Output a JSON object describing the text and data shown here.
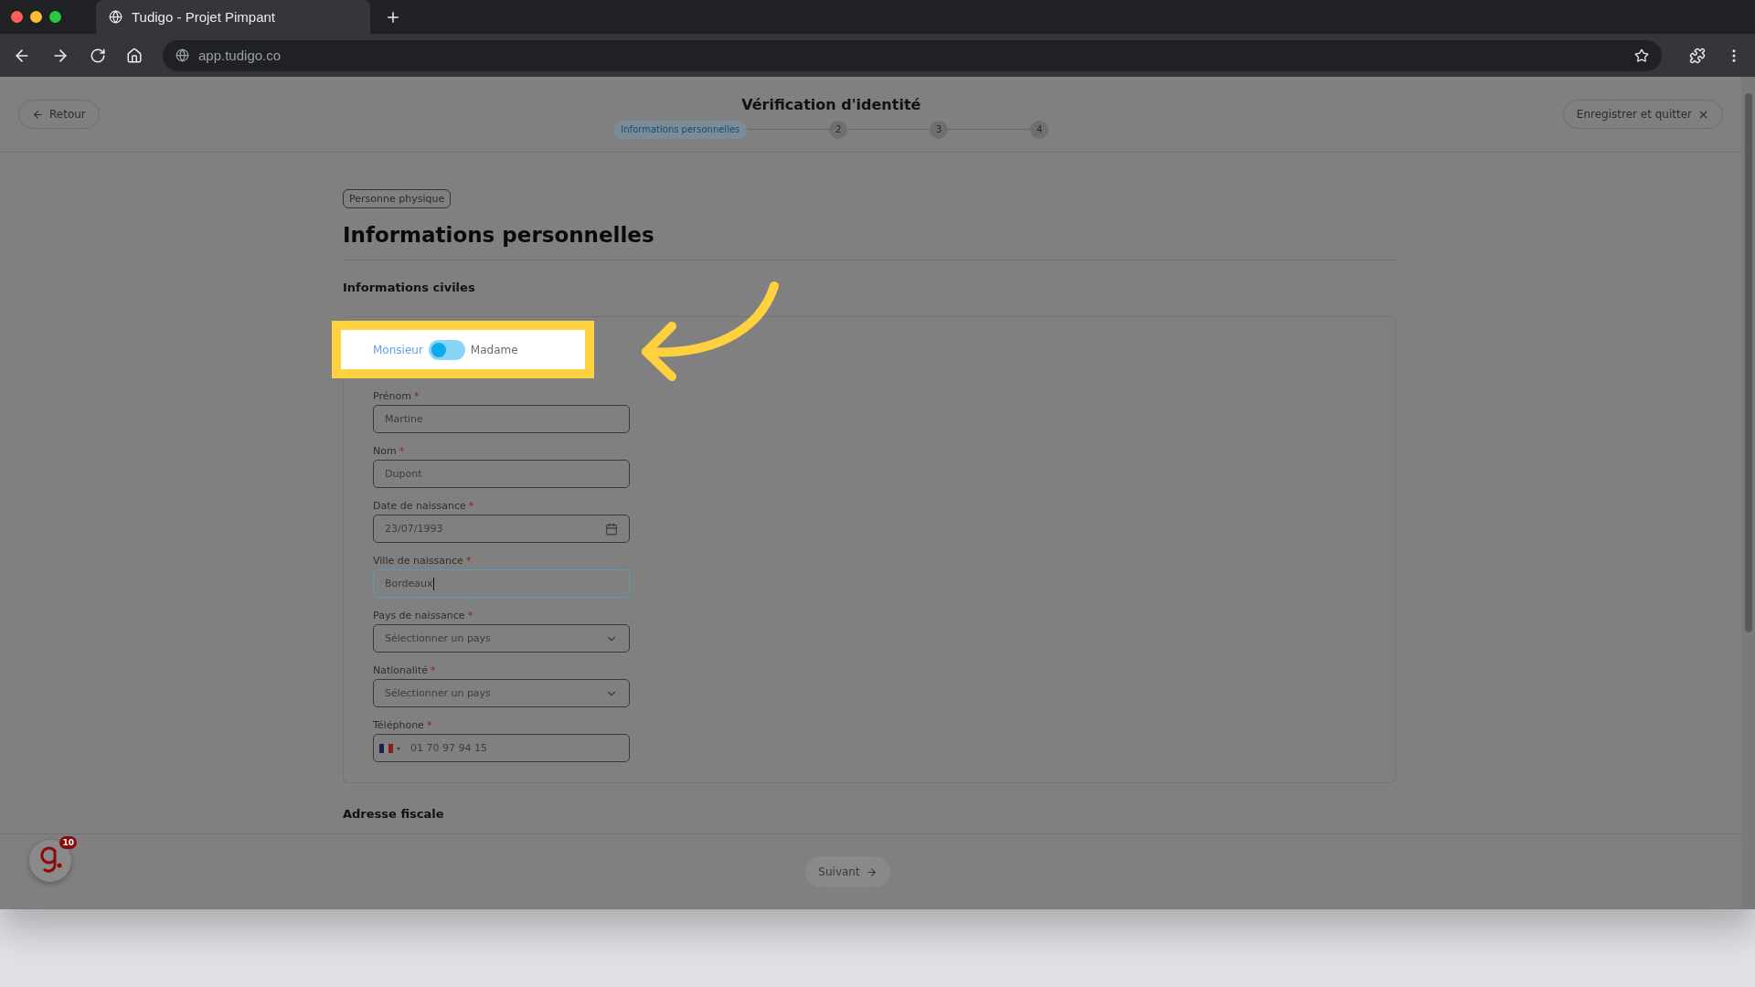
{
  "browser": {
    "tab_title": "Tudigo - Projet Pimpant",
    "url": "app.tudigo.co"
  },
  "header": {
    "back_button": "Retour",
    "title": "Vérification d'identité",
    "save_button": "Enregistrer et quitter",
    "steps": [
      {
        "label": "Informations personnelles",
        "selected": true
      },
      {
        "label": "2",
        "selected": false
      },
      {
        "label": "3",
        "selected": false
      },
      {
        "label": "4",
        "selected": false
      }
    ]
  },
  "badge": "Personne physique",
  "heading": "Informations personnelles",
  "section_title": "Informations civiles",
  "gender": {
    "options": [
      {
        "label": "Monsieur",
        "selected": true
      },
      {
        "label": "Madame",
        "selected": false
      }
    ]
  },
  "fields": [
    {
      "kind": "text",
      "label": "Prénom",
      "asterisk": "*",
      "placeholder": "Martine",
      "focused": false
    },
    {
      "kind": "text",
      "label": "Nom",
      "asterisk": "*",
      "placeholder": "Dupont",
      "focused": false
    },
    {
      "kind": "date",
      "label": "Date de naissance",
      "asterisk": "*",
      "placeholder": "23/07/1993",
      "focused": false
    },
    {
      "kind": "text",
      "label": "Ville de naissance",
      "asterisk": "*",
      "value": "Bordeaux",
      "focused": true
    },
    {
      "kind": "select",
      "label": "Pays de naissance",
      "asterisk": "*",
      "placeholder": "Sélectionner un pays",
      "focused": false
    },
    {
      "kind": "select",
      "label": "Nationalité",
      "asterisk": "*",
      "placeholder": "Sélectionner un pays",
      "focused": false
    },
    {
      "kind": "phone",
      "label": "Téléphone",
      "asterisk": "*",
      "placeholder": "01 70 97 94 15",
      "focused": false
    }
  ],
  "next_section": "Adresse fiscale",
  "footer": {
    "next_button": "Suivant",
    "chat_badge": "10"
  }
}
